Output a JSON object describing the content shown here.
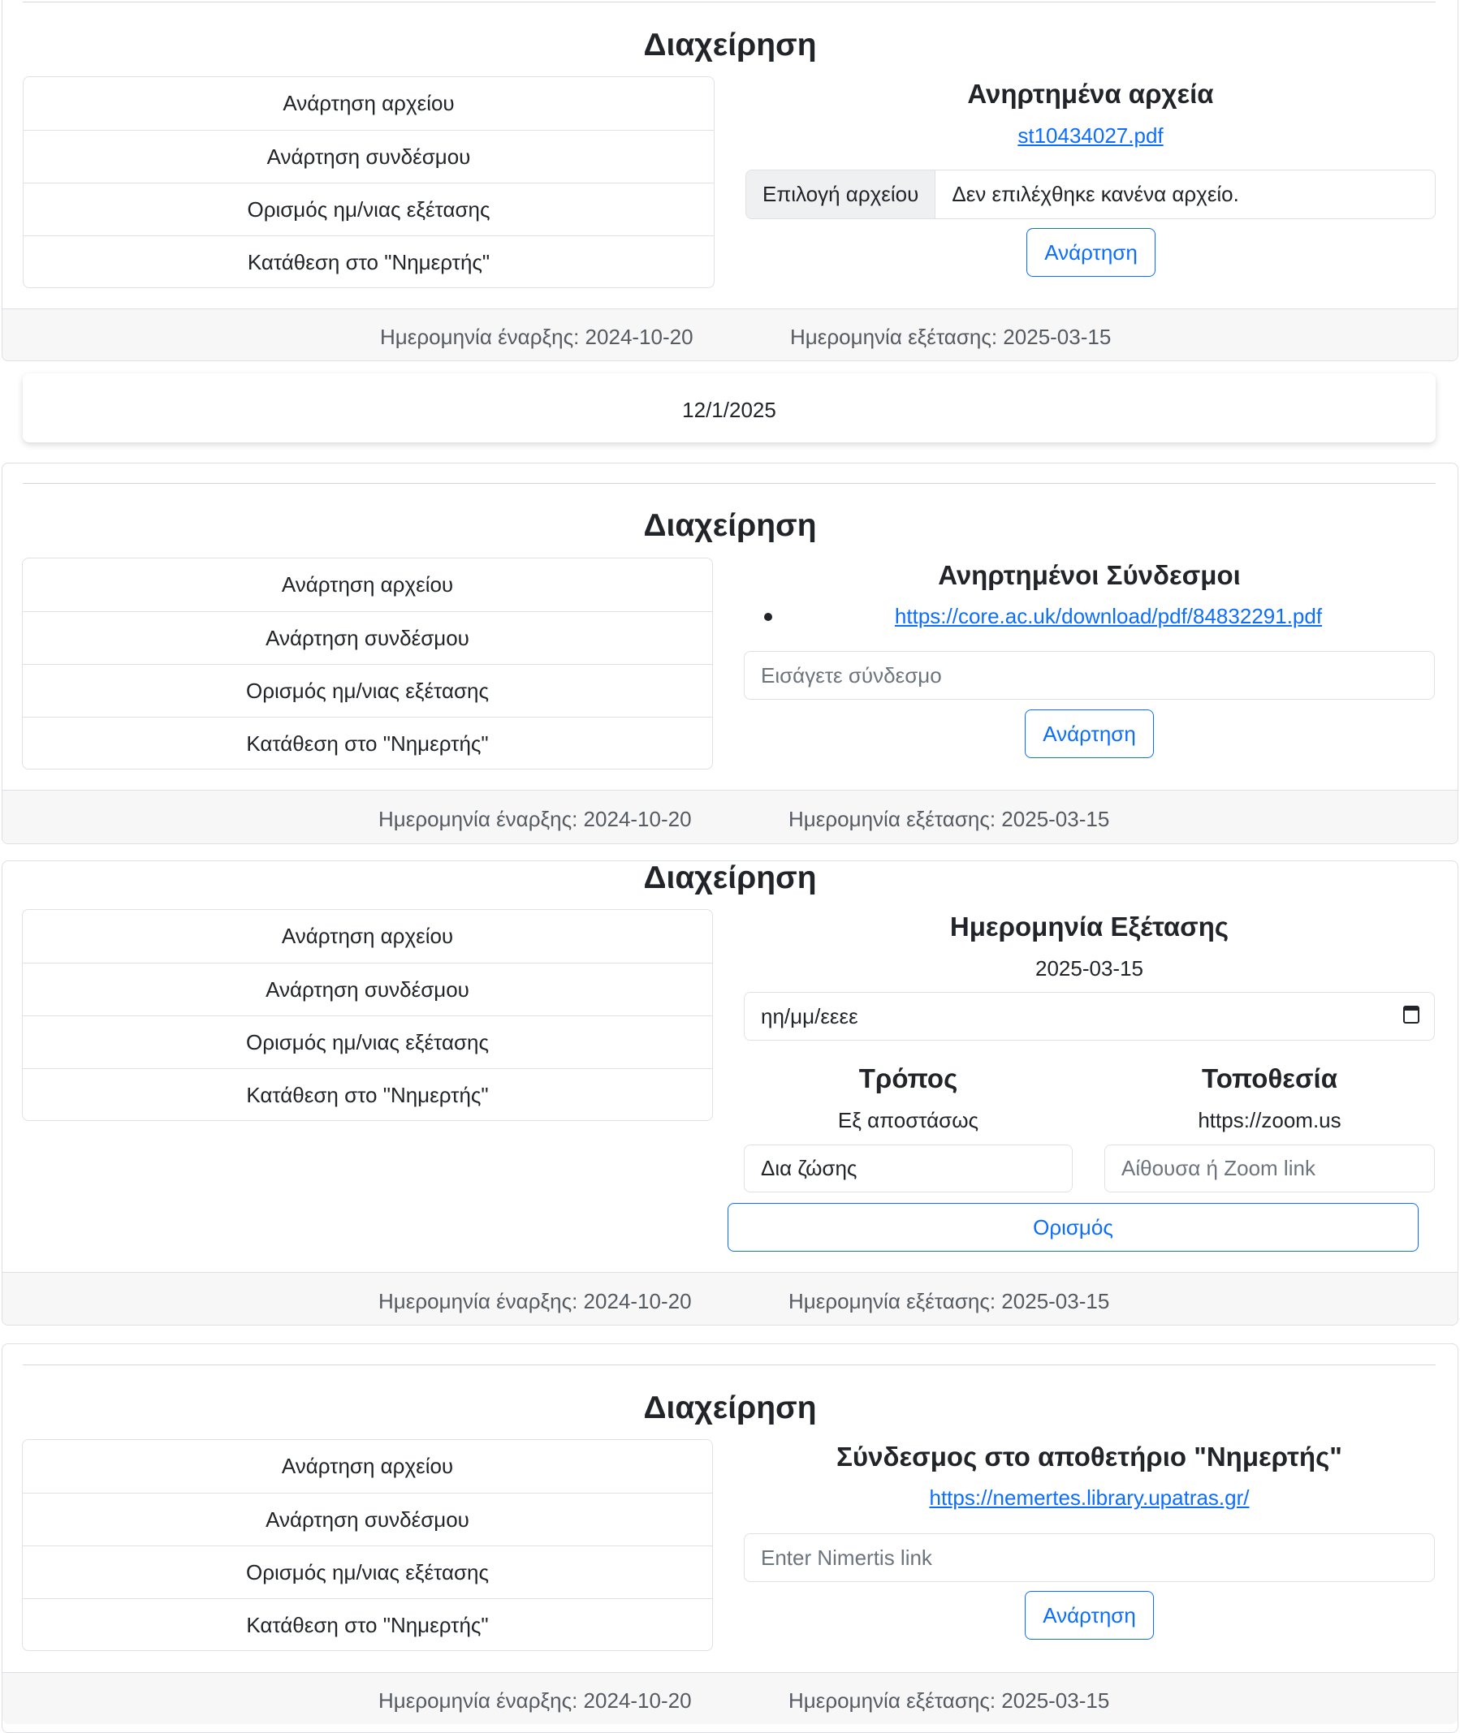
{
  "menu": {
    "items": [
      "Ανάρτηση αρχείου",
      "Ανάρτηση συνδέσμου",
      "Ορισμός ημ/νιας εξέτασης",
      "Κατάθεση στο \"Νημερτής\""
    ]
  },
  "footer": {
    "start_date": "Ημερομηνία έναρξης: 2024-10-20",
    "exam_date": "Ημερομηνία εξέτασης: 2025-03-15"
  },
  "section1": {
    "title": "Διαχείρηση",
    "subtitle": "Ανηρτημένα αρχεία",
    "file_link": "st10434027.pdf",
    "file_button": "Επιλογή αρχείου",
    "file_status": "Δεν επιλέχθηκε κανένα αρχείο.",
    "submit": "Ανάρτηση"
  },
  "date_card": {
    "text": "12/1/2025"
  },
  "section2": {
    "title": "Διαχείρηση",
    "subtitle": "Ανηρτημένοι Σύνδεσμοι",
    "link": "https://core.ac.uk/download/pdf/84832291.pdf",
    "input_placeholder": "Εισάγετε σύνδεσμο",
    "submit": "Ανάρτηση"
  },
  "section3": {
    "title": "Διαχείρηση",
    "subtitle": "Ημερομηνία Εξέτασης",
    "current_date": "2025-03-15",
    "date_input": "ηη/μμ/εεεε",
    "mode_title": "Τρόπος",
    "mode_value": "Εξ αποστάσως",
    "mode_select": "Δια ζώσης",
    "location_title": "Τοποθεσία",
    "location_value": "https://zoom.us",
    "location_placeholder": "Αίθουσα ή Zoom link",
    "submit": "Ορισμός"
  },
  "section4": {
    "title": "Διαχείρηση",
    "subtitle": "Σύνδεσμος στο αποθετήριο \"Νημερτής\"",
    "link": "https://nemertes.library.upatras.gr/",
    "input_placeholder": "Enter Nimertis link",
    "submit": "Ανάρτηση"
  }
}
